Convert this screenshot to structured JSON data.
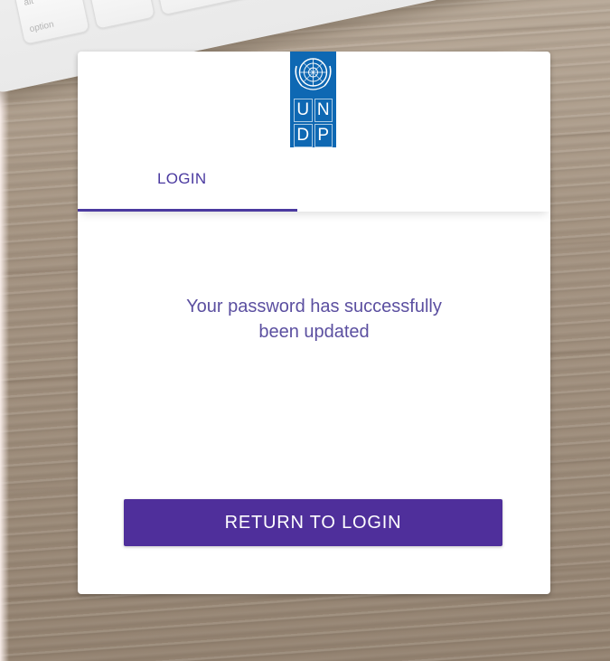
{
  "keyboard": {
    "keys": [
      "alt",
      "option"
    ]
  },
  "logo": {
    "letters": [
      "U",
      "N",
      "D",
      "P"
    ]
  },
  "tabs": [
    {
      "label": "LOGIN",
      "active": true
    }
  ],
  "message": {
    "line1": "Your password has successfully",
    "line2": "been updated"
  },
  "button": {
    "label": "RETURN TO LOGIN"
  },
  "colors": {
    "accent": "#4b3aa0",
    "button": "#4f2f9b",
    "logo_blue": "#0e68b3"
  },
  "icons": {
    "emblem": "un-emblem-icon"
  }
}
